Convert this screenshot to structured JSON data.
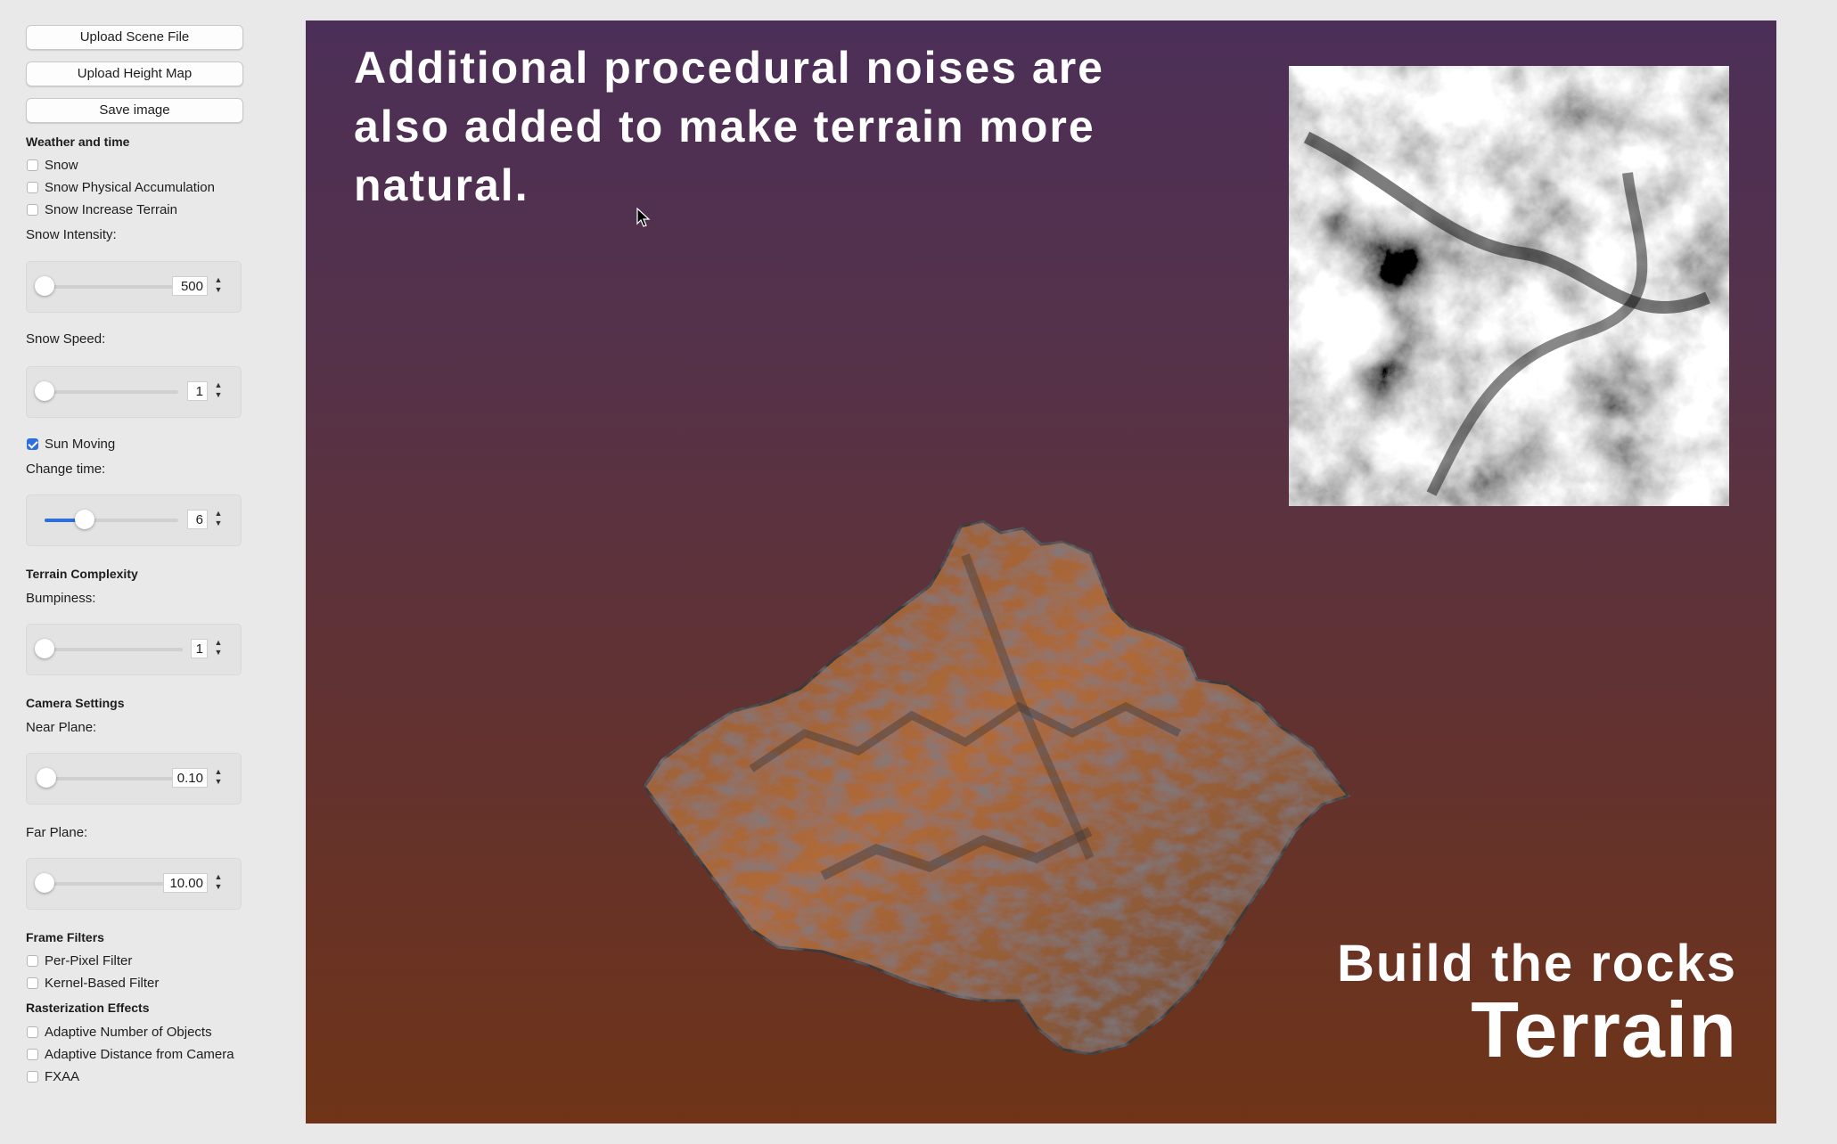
{
  "sidebar": {
    "buttons": {
      "upload_scene": "Upload Scene File",
      "upload_height": "Upload Height Map",
      "save_image": "Save image"
    },
    "weather": {
      "heading": "Weather and time",
      "snow": {
        "label": "Snow",
        "checked": false
      },
      "snow_accum": {
        "label": "Snow Physical Accumulation",
        "checked": false
      },
      "snow_terrain": {
        "label": "Snow Increase Terrain",
        "checked": false
      },
      "snow_intensity": {
        "label": "Snow Intensity:",
        "value": "500",
        "slider_fraction": 0
      },
      "snow_speed": {
        "label": "Snow Speed:",
        "value": "1",
        "slider_fraction": 0
      },
      "sun_moving": {
        "label": "Sun Moving",
        "checked": true
      },
      "change_time": {
        "label": "Change time:",
        "value": "6",
        "slider_fraction": 0.3
      }
    },
    "terrain": {
      "heading": "Terrain Complexity",
      "bumpiness": {
        "label": "Bumpiness:",
        "value": "1",
        "slider_fraction": 0
      }
    },
    "camera": {
      "heading": "Camera Settings",
      "near": {
        "label": "Near Plane:",
        "value": "0.10",
        "slider_fraction": 0.01
      },
      "far": {
        "label": "Far Plane:",
        "value": "10.00",
        "slider_fraction": 0
      }
    },
    "filters": {
      "heading": "Frame Filters",
      "per_pixel": {
        "label": "Per-Pixel Filter",
        "checked": false
      },
      "kernel": {
        "label": "Kernel-Based Filter",
        "checked": false
      }
    },
    "raster": {
      "heading": "Rasterization Effects",
      "adaptive_objects": {
        "label": "Adaptive Number of Objects",
        "checked": false
      },
      "adaptive_distance": {
        "label": "Adaptive Distance from Camera",
        "checked": false
      },
      "fxaa": {
        "label": "FXAA",
        "checked": false
      }
    }
  },
  "viewport": {
    "caption": "Additional procedural noises are also added to make terrain more natural.",
    "subtitle": "Build the rocks",
    "title": "Terrain",
    "colors": {
      "sky_top": "#4c2f58",
      "sky_bottom": "#6f3418",
      "rock": "#b06a38",
      "accent": "#2f6fdc"
    }
  }
}
